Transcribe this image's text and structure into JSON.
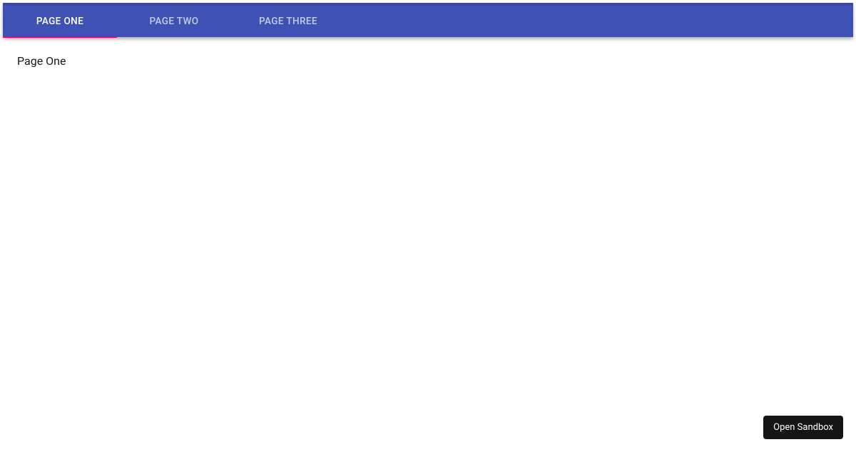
{
  "tabs": [
    {
      "label": "Page One",
      "active": true
    },
    {
      "label": "Page Two",
      "active": false
    },
    {
      "label": "Page Three",
      "active": false
    }
  ],
  "content": {
    "text": "Page One"
  },
  "sandbox": {
    "label": "Open Sandbox"
  },
  "colors": {
    "primary": "#3f51b5",
    "secondary": "#f50057"
  }
}
